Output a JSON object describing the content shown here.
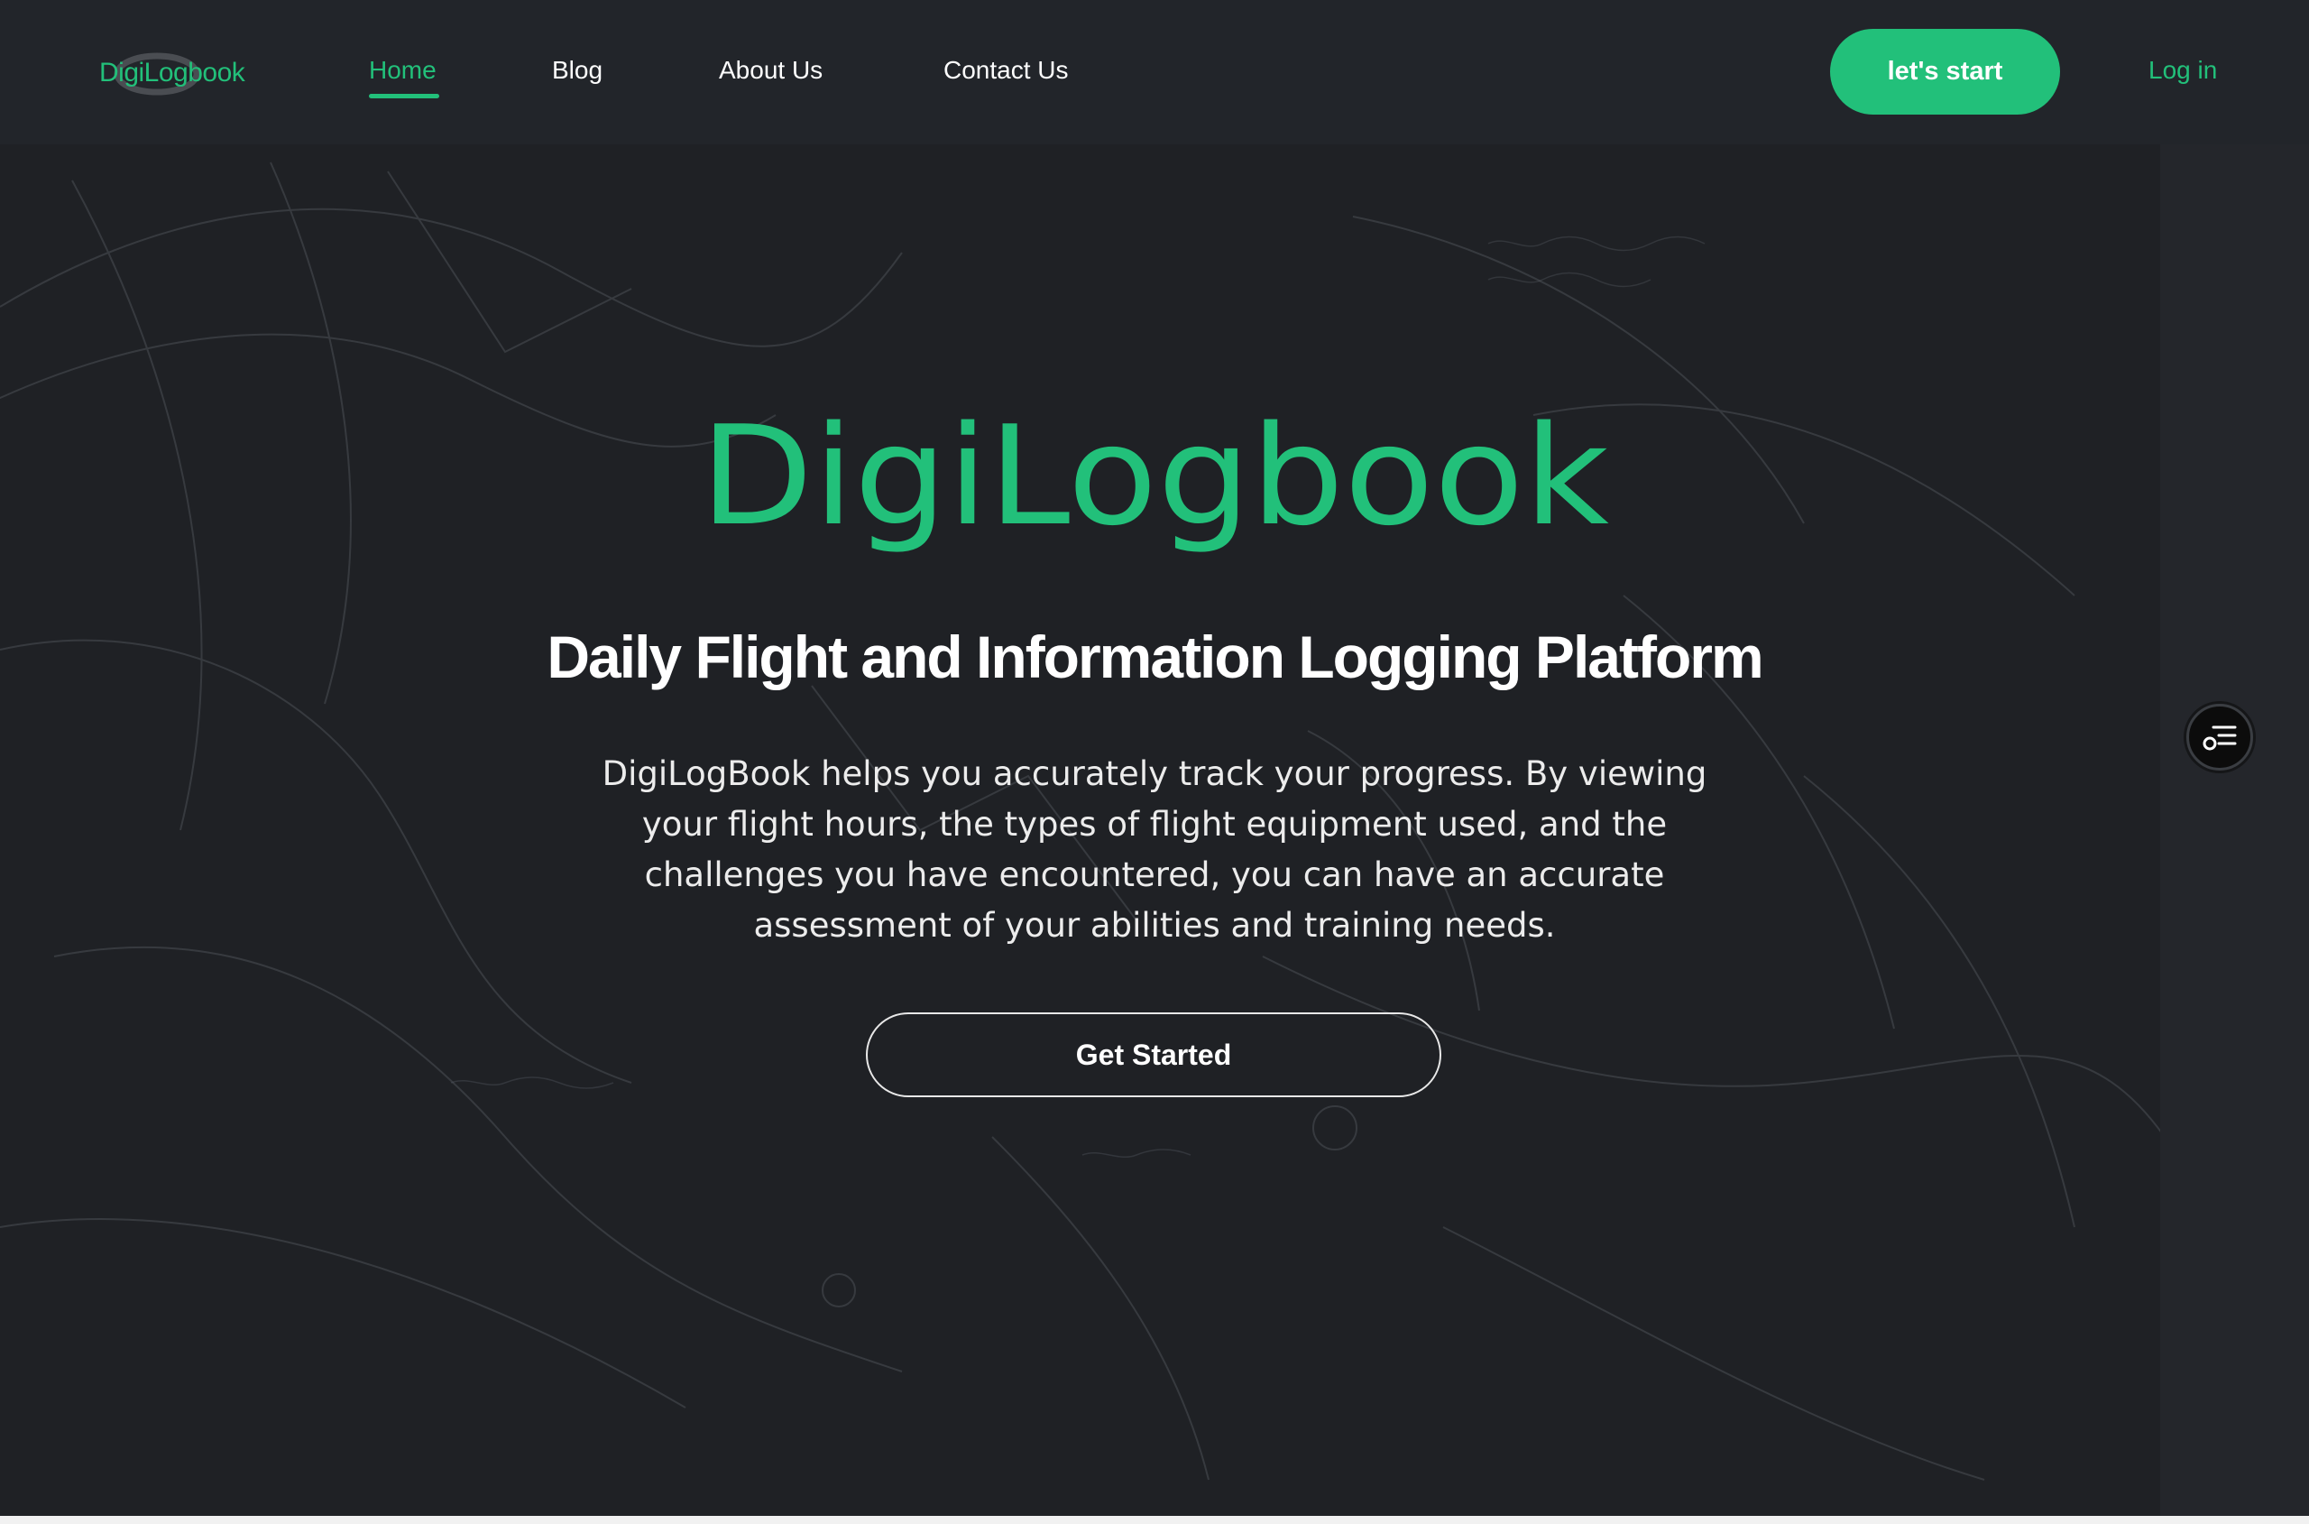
{
  "header": {
    "logo_text": "DigiLogbook",
    "nav": [
      {
        "label": "Home",
        "active": true
      },
      {
        "label": "Blog",
        "active": false
      },
      {
        "label": "About Us",
        "active": false
      },
      {
        "label": "Contact Us",
        "active": false
      }
    ],
    "start_button": "let's start",
    "login_link": "Log in"
  },
  "hero": {
    "wordmark": "DigiLogbook",
    "title": "Daily Flight and Information Logging Platform",
    "description": "DigiLogBook helps you accurately track your progress. By viewing your flight hours, the types of flight equipment used, and the challenges you have encountered, you can have an accurate assessment of your abilities and training needs.",
    "cta": "Get Started"
  },
  "floating": {
    "icon": "menu-list-icon"
  },
  "colors": {
    "accent": "#22c07a",
    "background": "#1f2125",
    "header": "#22252a"
  }
}
